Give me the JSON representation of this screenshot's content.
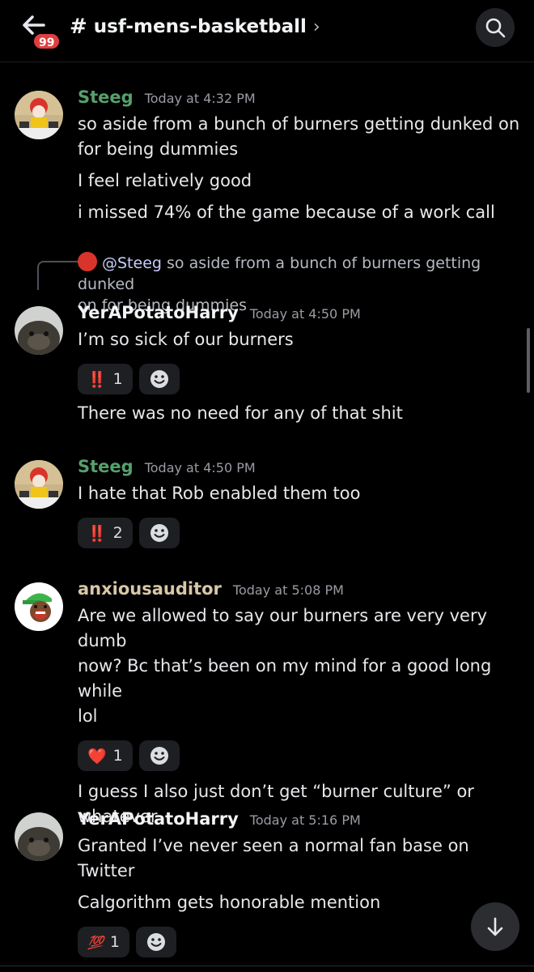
{
  "header": {
    "unread_count": "99",
    "channel_hash": "#",
    "channel_name": "usf-mens-basketball",
    "chevron": "›"
  },
  "messages": [
    {
      "author": "Steeg",
      "timestamp": "Today at 4:32 PM",
      "avatar_icon": "mcdonald-meme-avatar",
      "lines": [
        "so aside from a bunch of burners getting dunked on",
        "for being dummies",
        "I feel relatively good",
        "i missed 74% of the game because of a work call"
      ]
    },
    {
      "reply_to": {
        "mention": "@Steeg",
        "text": "so aside from a bunch of burners getting dunked",
        "text2": "on for being dummies"
      },
      "author": "YerAPotatoHarry",
      "timestamp": "Today at 4:50 PM",
      "avatar_icon": "seal-avatar",
      "lines": [
        "I’m so sick of our burners",
        "There was no need for any of that shit"
      ],
      "reactions": [
        {
          "emoji": "‼️",
          "count": "1"
        }
      ]
    },
    {
      "author": "Steeg",
      "timestamp": "Today at 4:50 PM",
      "avatar_icon": "mcdonald-meme-avatar",
      "lines": [
        "I hate that Rob enabled them too"
      ],
      "reactions": [
        {
          "emoji": "‼️",
          "count": "2"
        }
      ]
    },
    {
      "author": "anxiousauditor",
      "timestamp": "Today at 5:08 PM",
      "avatar_icon": "cartoon-avatar",
      "lines": [
        "Are we allowed to say our burners are very very dumb",
        "now? Bc that’s been on my mind for a good long while",
        "lol",
        "I guess I also just don’t get “burner culture” or",
        "whatever"
      ],
      "reactions": [
        {
          "emoji": "❤️",
          "count": "1"
        }
      ]
    },
    {
      "author": "YerAPotatoHarry",
      "timestamp": "Today at 5:16 PM",
      "avatar_icon": "seal-avatar",
      "lines": [
        "Granted I’ve never seen a normal fan base on Twitter",
        "Calgorithm gets honorable mention"
      ],
      "reactions": [
        {
          "emoji": "💯",
          "count": "1"
        }
      ]
    }
  ],
  "colors": {
    "background": "#000000",
    "author_green": "#57a06b",
    "author_tan": "#d8c7a8",
    "badge_red": "#e03e3e",
    "reaction_bg": "#1e1f22"
  },
  "icons": [
    "back-arrow-icon",
    "search-icon",
    "add-reaction-icon",
    "scroll-down-icon"
  ]
}
